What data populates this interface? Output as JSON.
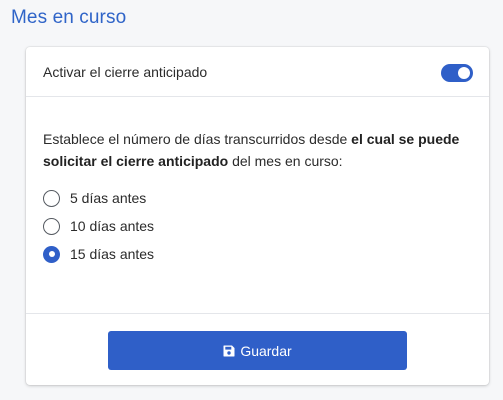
{
  "section": {
    "title": "Mes en curso"
  },
  "card": {
    "header_label": "Activar el cierre anticipado",
    "toggle_on": true,
    "description_part1": "Establece el número de días transcurridos desde ",
    "description_bold": "el cual se puede solicitar el cierre anticipado",
    "description_part2": " del mes en curso:",
    "options": [
      {
        "label": "5 días antes",
        "checked": false
      },
      {
        "label": "10 días antes",
        "checked": false
      },
      {
        "label": "15 días antes",
        "checked": true
      }
    ],
    "save_label": "Guardar",
    "save_icon": "floppy-disk-icon"
  },
  "colors": {
    "accent": "#2f5fc8",
    "title": "#2f64c8"
  }
}
